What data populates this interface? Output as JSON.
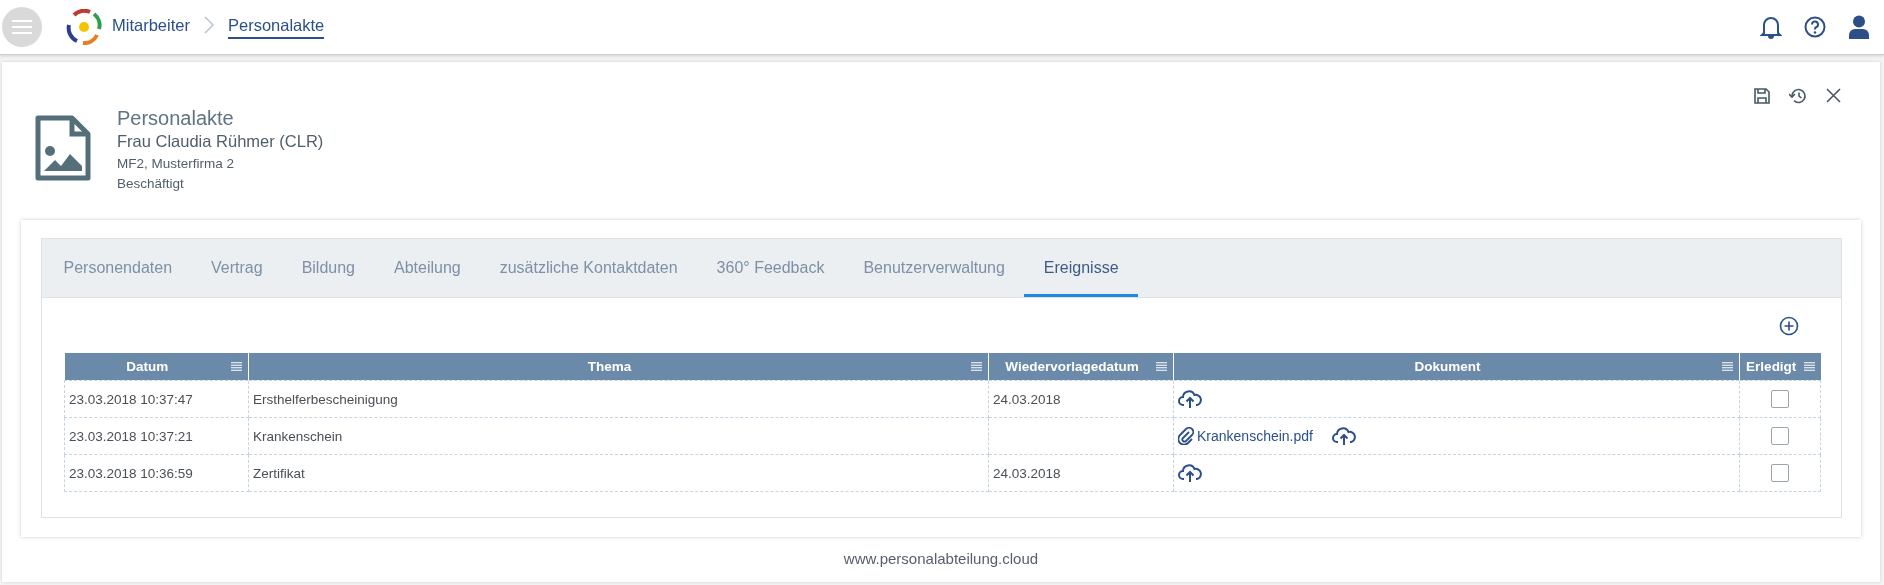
{
  "top_bar": {
    "breadcrumbs": [
      {
        "label": "Mitarbeiter",
        "selected": false
      },
      {
        "label": "Personalakte",
        "selected": true
      }
    ]
  },
  "header": {
    "title": "Personalakte",
    "name": "Frau Claudia Rühmer (CLR)",
    "company": "MF2, Musterfirma 2",
    "status": "Beschäftigt"
  },
  "tabs": [
    {
      "label": "Personendaten",
      "selected": false
    },
    {
      "label": "Vertrag",
      "selected": false
    },
    {
      "label": "Bildung",
      "selected": false
    },
    {
      "label": "Abteilung",
      "selected": false
    },
    {
      "label": "zusätzliche Kontaktdaten",
      "selected": false
    },
    {
      "label": "360° Feedback",
      "selected": false
    },
    {
      "label": "Benutzerverwaltung",
      "selected": false
    },
    {
      "label": "Ereignisse",
      "selected": true
    }
  ],
  "table": {
    "columns": [
      "Datum",
      "Thema",
      "Wiedervorlagedatum",
      "Dokument",
      "Erledigt"
    ],
    "rows": [
      {
        "datum": "23.03.2018 10:37:47",
        "thema": "Ersthelferbescheinigung",
        "wiedervorlage": "24.03.2018",
        "erledigt": false
      },
      {
        "datum": "23.03.2018 10:37:21",
        "thema": "Krankenschein",
        "attachments": [
          "Krankenschein.pdf"
        ],
        "erledigt": false
      },
      {
        "datum": "23.03.2018 10:36:59",
        "thema": "Zertifikat",
        "wiedervorlage": "24.03.2018",
        "erledigt": false
      }
    ]
  },
  "footer": "www.personalabteilung.cloud"
}
